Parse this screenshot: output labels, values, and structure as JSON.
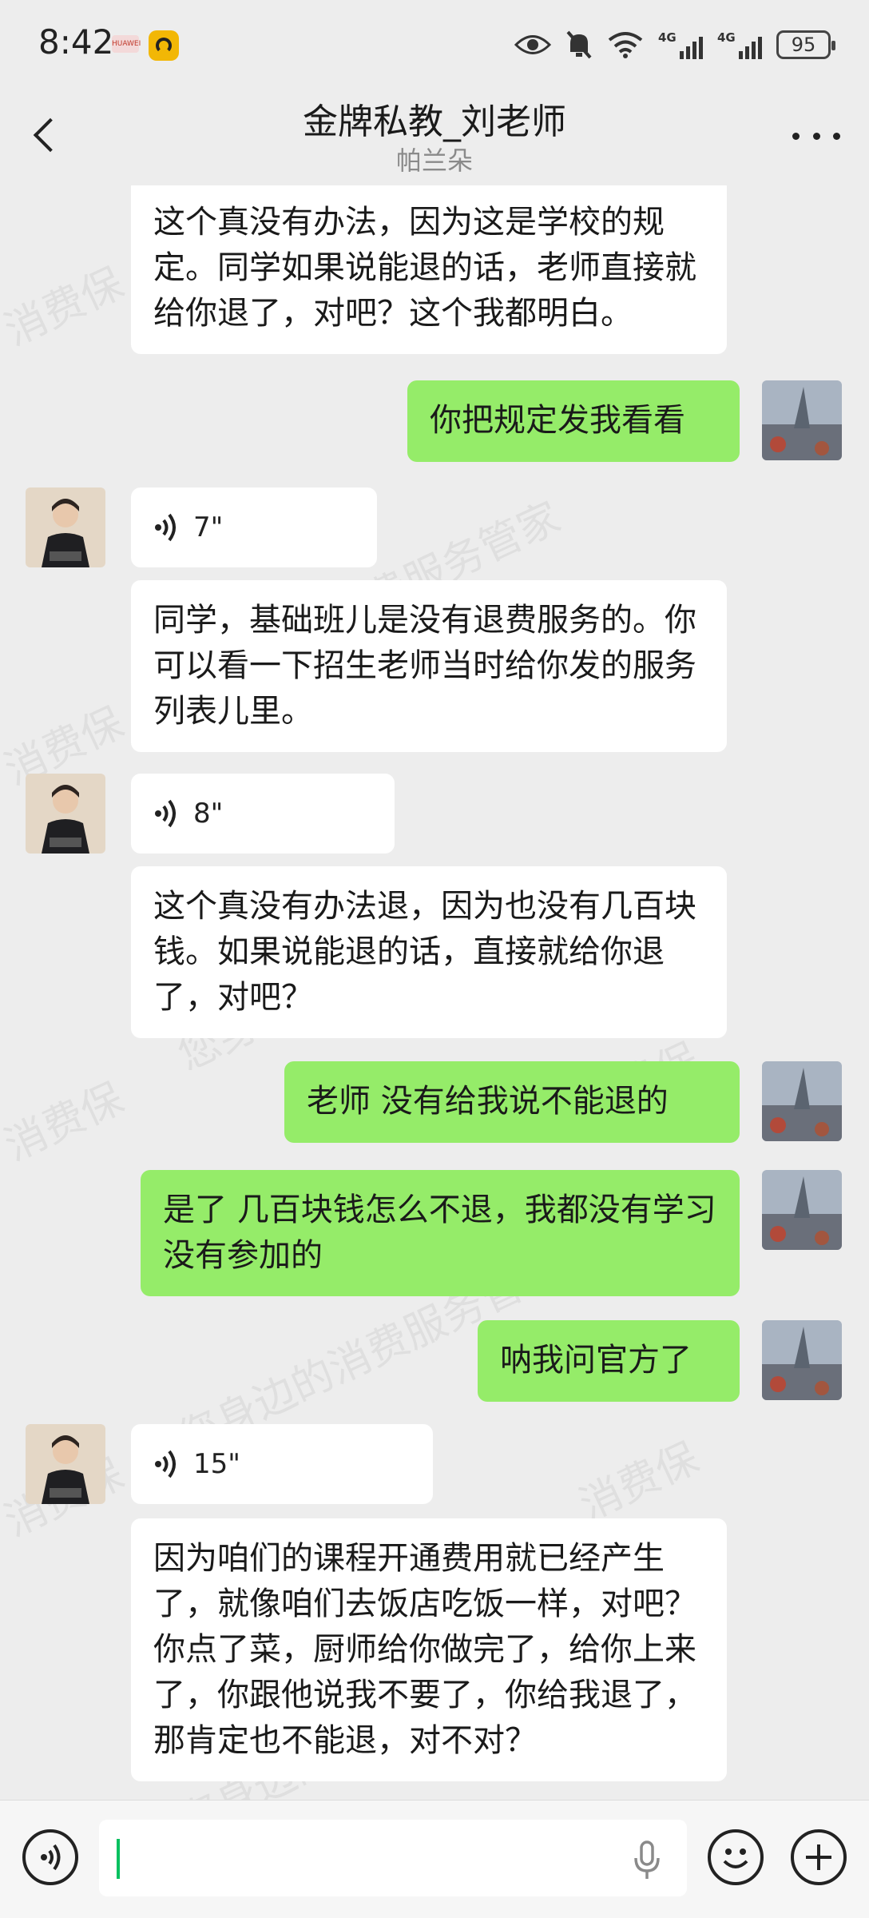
{
  "status_bar": {
    "time": "8:42",
    "brand": "HUAWEI",
    "network_1": "4G",
    "network_2": "4G",
    "battery": "95"
  },
  "header": {
    "title": "金牌私教_刘老师",
    "subtitle": "帕兰朵"
  },
  "messages": [
    {
      "side": "received",
      "type": "text",
      "text": "这个真没有办法，因为这是学校的规定。同学如果说能退的话，老师直接就给你退了，对吧？这个我都明白。"
    },
    {
      "side": "sent",
      "type": "text",
      "text": "你把规定发我看看"
    },
    {
      "side": "received",
      "type": "voice",
      "duration": "7\""
    },
    {
      "side": "received",
      "type": "text",
      "text": "同学，基础班儿是没有退费服务的。你可以看一下招生老师当时给你发的服务列表儿里。"
    },
    {
      "side": "received",
      "type": "voice",
      "duration": "8\""
    },
    {
      "side": "received",
      "type": "text",
      "text": "这个真没有办法退，因为也没有几百块钱。如果说能退的话，直接就给你退了，对吧？"
    },
    {
      "side": "sent",
      "type": "text",
      "text": "老师  没有给我说不能退的"
    },
    {
      "side": "sent",
      "type": "text",
      "text": "是了  几百块钱怎么不退，我都没有学习没有参加的"
    },
    {
      "side": "sent",
      "type": "text",
      "text": "呐我问官方了"
    },
    {
      "side": "received",
      "type": "voice",
      "duration": "15\""
    },
    {
      "side": "received",
      "type": "text",
      "text": "因为咱们的课程开通费用就已经产生了，就像咱们去饭店吃饭一样，对吧？你点了菜，厨师给你做完了，给你上来了，你跟他说我不要了，你给我退了，那肯定也不能退，对不对？"
    }
  ],
  "watermark": {
    "line_a": "消费保",
    "line_b": "您身边的消费服务管家"
  },
  "input": {
    "value": ""
  },
  "colors": {
    "background": "#ededed",
    "sent_bubble": "#95ec69",
    "received_bubble": "#ffffff",
    "caret": "#07c160"
  }
}
